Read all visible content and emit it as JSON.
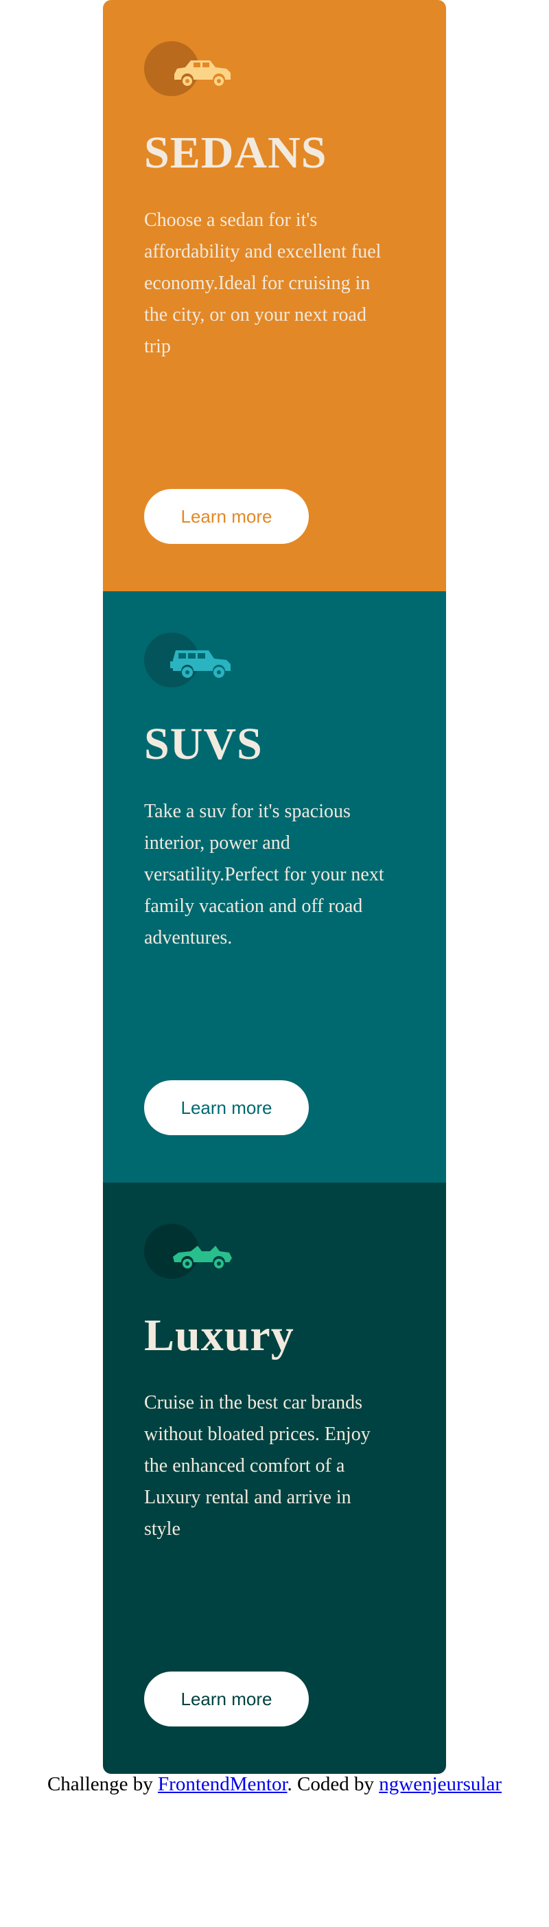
{
  "cards": [
    {
      "title": "SEDANS",
      "text": "Choose a sedan for it's affordability and excellent fuel economy.Ideal for cruising in the city, or on your next road trip",
      "button_label": "Learn more",
      "icon": "sedan-car-icon",
      "colors": {
        "background": "#e38826",
        "title": "#f2eadf",
        "text": "#f2eadf",
        "icon": "#fcd487",
        "icon_circle": "#b96a1d",
        "button_text": "#e38826"
      }
    },
    {
      "title": "SUVS",
      "text": "Take a suv for it's spacious interior, power and versatility.Perfect for your next family vacation and off road adventures.",
      "button_label": "Learn more",
      "icon": "suv-car-icon",
      "colors": {
        "background": "#006970",
        "title": "#f2eadf",
        "text": "#f2eadf",
        "icon": "#2ab3c0",
        "icon_circle": "#04555b",
        "button_text": "#006970"
      }
    },
    {
      "title": "Luxury",
      "text": "Cruise in the best car brands without bloated prices. Enjoy the enhanced comfort of a Luxury rental and arrive in style",
      "button_label": "Learn more",
      "icon": "luxury-car-icon",
      "colors": {
        "background": "#004241",
        "title": "#f2eadf",
        "text": "#f2eadf",
        "icon": "#28bf8c",
        "icon_circle": "#013232",
        "button_text": "#004241"
      }
    }
  ],
  "attribution": {
    "prefix": "Challenge by ",
    "link1": "FrontendMentor",
    "middle": ". Coded by ",
    "link2": "ngwenjeursular"
  }
}
